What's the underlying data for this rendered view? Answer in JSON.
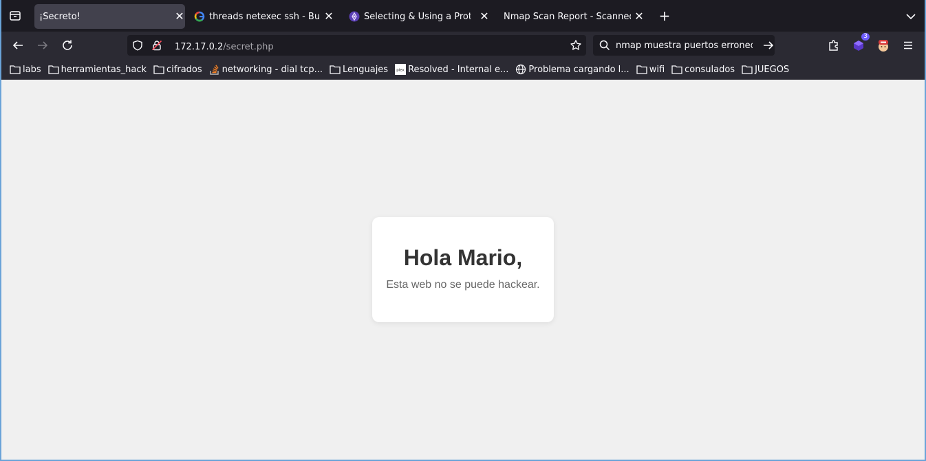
{
  "browser": {
    "tabs": [
      {
        "title": "¡Secreto!",
        "active": true,
        "favicon": "none"
      },
      {
        "title": "threads netexec ssh - Buscar c",
        "active": false,
        "favicon": "google-icon"
      },
      {
        "title": "Selecting & Using a Protocol |",
        "active": false,
        "favicon": "protocol-icon"
      },
      {
        "title": "Nmap Scan Report - Scanned at S",
        "active": false,
        "favicon": "none"
      }
    ],
    "close_glyph": "✕",
    "new_tab_glyph": "+",
    "url": {
      "host": "172.17.0.2",
      "path": "/secret.php"
    },
    "search": {
      "value": "nmap muestra puertos erroneos"
    },
    "extension_badge": "3",
    "bookmarks": [
      {
        "label": "labs",
        "icon": "folder-icon"
      },
      {
        "label": "herramientas_hack",
        "icon": "folder-icon"
      },
      {
        "label": "cifrados",
        "icon": "folder-icon"
      },
      {
        "label": "networking - dial tcp...",
        "icon": "stackoverflow-icon"
      },
      {
        "label": "Lenguajes",
        "icon": "folder-icon"
      },
      {
        "label": "Resolved - Internal e...",
        "icon": "plex-icon"
      },
      {
        "label": "Problema cargando l...",
        "icon": "globe-icon"
      },
      {
        "label": "wifi",
        "icon": "folder-icon"
      },
      {
        "label": "consulados",
        "icon": "folder-icon"
      },
      {
        "label": "JUEGOS",
        "icon": "folder-icon"
      }
    ],
    "plex_icon_text": "plex"
  },
  "page": {
    "heading": "Hola Mario,",
    "message": "Esta web no se puede hackear."
  },
  "colors": {
    "tabstrip": "#1c1b22",
    "toolbar": "#2b2a33",
    "page_background": "#f0f0f0",
    "card": "#ffffff",
    "heading": "#333333",
    "message": "#666666"
  }
}
